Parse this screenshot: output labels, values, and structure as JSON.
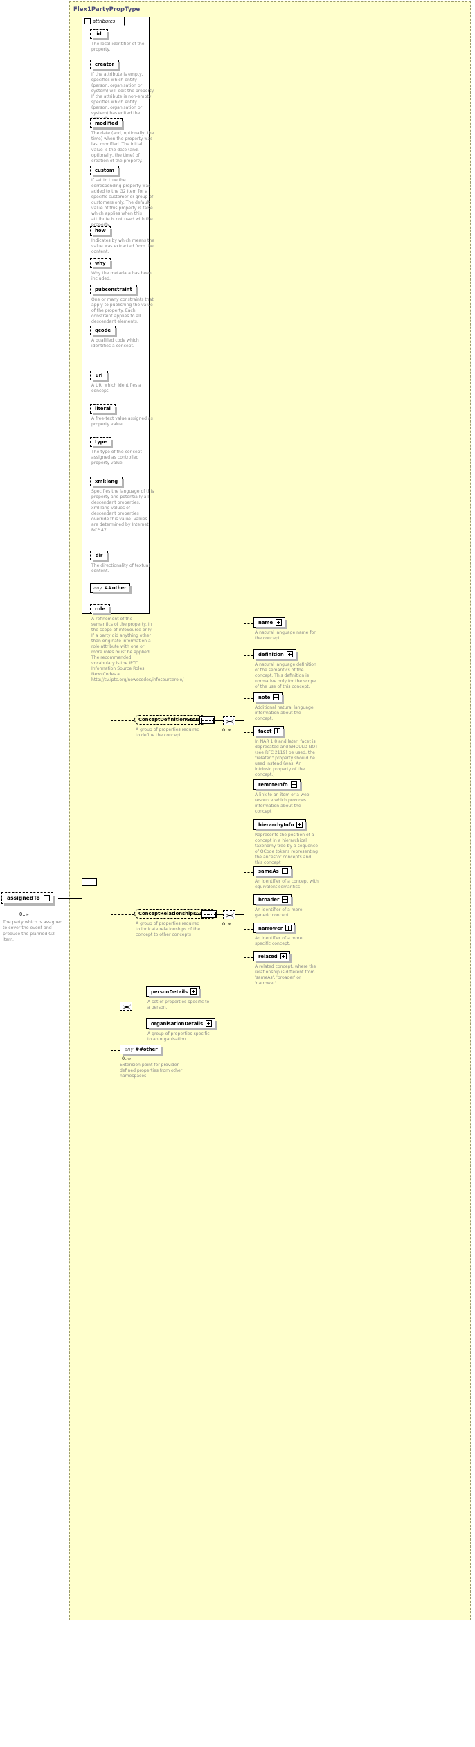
{
  "diagram": {
    "type_name": "Flex1PartyPropType",
    "attributes_label": "attributes"
  },
  "root_element": {
    "name": "assignedTo",
    "cardinality": "0..∞",
    "description": "The party which is assigned to cover the event and produce the planned G2 item."
  },
  "attributes": [
    {
      "name": "id",
      "description": "The local identifier of the property."
    },
    {
      "name": "creator",
      "description": "If the attribute is empty, specifies which entity (person, organisation or system) will edit the property. If the attribute is non-empty, specifies which entity (person, organisation or system) has edited the property."
    },
    {
      "name": "modified",
      "description": "The date (and, optionally, the time) when the property was last modified. The initial value is the date (and, optionally, the time) of creation of the property."
    },
    {
      "name": "custom",
      "description": "If set to true the corresponding property was added to the G2 Item for a specific customer or group of customers only. The default value of this property is false which applies when this attribute is not used with the property."
    },
    {
      "name": "how",
      "description": "Indicates by which means the value was extracted from the content."
    },
    {
      "name": "why",
      "description": "Why the metadata has been included."
    },
    {
      "name": "pubconstraint",
      "description": "One or many constraints that apply to publishing the value of the property. Each constraint applies to all descendant elements."
    },
    {
      "name": "qcode",
      "description": "A qualified code which identifies a concept."
    },
    {
      "name": "uri",
      "description": "A URI which identifies a concept."
    },
    {
      "name": "literal",
      "description": "A free-text value assigned as property value."
    },
    {
      "name": "type",
      "description": "The type of the concept assigned as controlled property value."
    },
    {
      "name": "xml:lang",
      "description": "Specifies the language of this property and potentially all descendant properties. xml:lang values of descendant properties override this value. Values are determined by Internet BCP 47."
    },
    {
      "name": "dir",
      "description": "The directionality of textual content."
    },
    {
      "name": "any ##other",
      "is_any": true,
      "any_word": "any",
      "any_name": "##other",
      "description": ""
    },
    {
      "name": "role",
      "description": "A refinement of the semantics of the property. In the scope of infoSource only: If a party did anything other than originate information a role attribute with one or more roles must be applied. The recommended vocabulary is the IPTC Information Source Roles NewsCodes at http://cv.iptc.org/newscodes/infosourcerole/"
    }
  ],
  "concept_definition_group": {
    "name": "ConceptDefinitionGroup",
    "description": "A group of properties required to define the concept",
    "cardinality": "0..∞",
    "members": [
      {
        "name": "name",
        "description": "A natural language name for the concept."
      },
      {
        "name": "definition",
        "description": "A natural language definition of the semantics of the concept. This definition is normative only for the scope of the use of this concept."
      },
      {
        "name": "note",
        "description": "Additional natural language information about the concept."
      },
      {
        "name": "facet",
        "description": "In NAR 1.8 and later, facet is deprecated and SHOULD NOT (see RFC 2119) be used, the \"related\" property should be used instead (was: An intrinsic property of the concept.)"
      },
      {
        "name": "remoteInfo",
        "description": "A link to an item or a web resource which provides information about the concept"
      },
      {
        "name": "hierarchyInfo",
        "description": "Represents the position of a concept in a hierarchical taxonomy tree by a sequence of QCode tokens representing the ancestor concepts and this concept"
      }
    ]
  },
  "concept_relationships_group": {
    "name": "ConceptRelationshipsGroup",
    "description": "A group of properties required to indicate relationships of the concept to other concepts",
    "cardinality": "0..∞",
    "members": [
      {
        "name": "sameAs",
        "description": "An identifier of a concept with equivalent semantics"
      },
      {
        "name": "broader",
        "description": "An identifier of a more generic concept."
      },
      {
        "name": "narrower",
        "description": "An identifier of a more specific concept."
      },
      {
        "name": "related",
        "description": "A related concept, where the relationship is different from 'sameAs', 'broader' or 'narrower'."
      }
    ]
  },
  "details_choice": {
    "members": [
      {
        "name": "personDetails",
        "description": "A set of properties specific to a person."
      },
      {
        "name": "organisationDetails",
        "description": "A group of properties specific to an organisation"
      }
    ]
  },
  "extension_any": {
    "any_word": "any",
    "any_name": "##other",
    "cardinality": "0..∞",
    "description": "Extension point for provider-defined properties from other namespaces"
  }
}
